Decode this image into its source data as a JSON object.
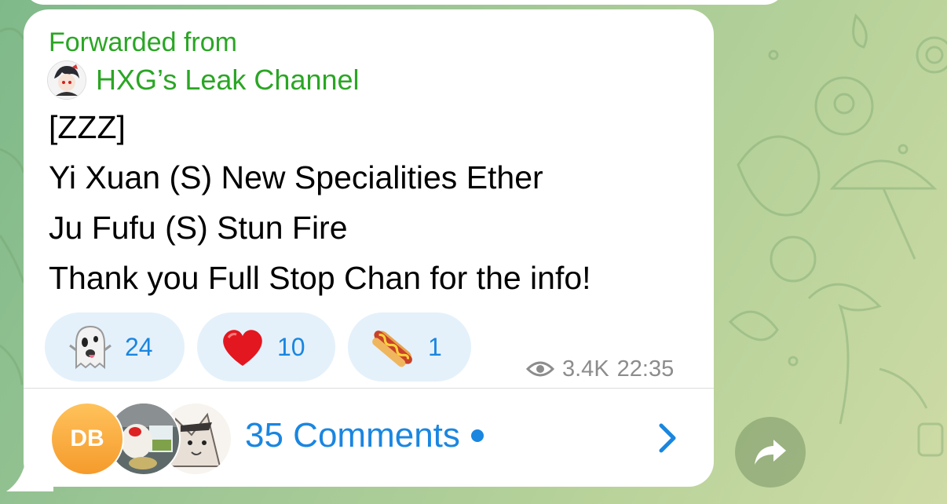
{
  "message": {
    "forwarded_label": "Forwarded from",
    "channel_name": "HXG’s Leak Channel",
    "lines": [
      "[ZZZ]",
      "Yi Xuan (S) New Specialities Ether",
      "Ju Fufu (S) Stun Fire",
      "Thank you Full Stop Chan for the info!"
    ],
    "reactions": [
      {
        "emoji": "ghost-emoji",
        "count": "24"
      },
      {
        "emoji": "red-heart-emoji",
        "count": "10"
      },
      {
        "emoji": "hot-dog-emoji",
        "count": "1"
      }
    ],
    "views": "3.4K",
    "time": "22:35"
  },
  "comments": {
    "label": "35 Comments",
    "avatar_initials": "DB"
  },
  "colors": {
    "link_green": "#2aa624",
    "accent_blue": "#1a86e0",
    "reaction_bg": "#e4f1fb"
  }
}
